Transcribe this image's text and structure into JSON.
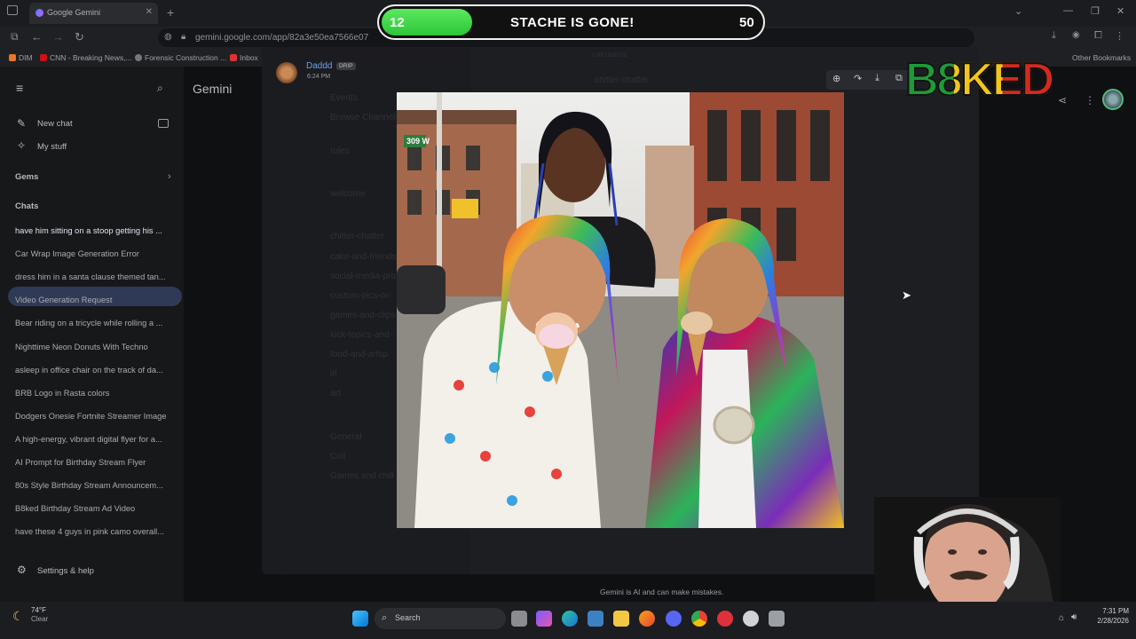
{
  "browser": {
    "tab_title": "Google Gemini",
    "url": "gemini.google.com/app/82a3e50ea7566e07",
    "bookmarks": [
      "DIM",
      "CNN - Breaking News,...",
      "Forensic Construction ...",
      "Inbox"
    ],
    "other_bookmarks": "Other Bookmarks"
  },
  "gemini": {
    "title": "Gemini",
    "new_chat": "New chat",
    "my_stuff": "My stuff",
    "gems": "Gems",
    "chats_header": "Chats",
    "chats": [
      "have him sitting on a stoop getting his ...",
      "Car Wrap Image Generation Error",
      "dress him in a santa clause themed tan...",
      "Video Generation Request",
      "Bear riding on a tricycle while rolling a ...",
      "Nighttime Neon Donuts With Techno",
      "asleep in office chair on the track of da...",
      "BRB Logo in Rasta colors",
      "Dodgers Onesie Fortnite Streamer Image",
      "A high-energy, vibrant digital flyer for a...",
      "AI Prompt for Birthday Stream Flyer",
      "80s Style Birthday Stream Announcem...",
      "B8ked Birthday Stream Ad Video",
      "have these 4 guys in pink camo overall..."
    ],
    "settings": "Settings & help",
    "disclaimer": "Gemini is AI and can make mistakes."
  },
  "discord_viewer": {
    "user": "Daddd",
    "role_badge": "DRIP",
    "time": "6:24 PM",
    "server": "calculators",
    "channel": "chitter-chatter",
    "ghost_channels": [
      "Events",
      "Browse Channels",
      "rules",
      "welcome",
      "chitter-chatter",
      "cake-and-friends",
      "social-media-pro",
      "custom-pics-or-",
      "games-and-clips",
      "kick-topics-and-",
      "food-and-artsp",
      "irl",
      "art",
      "General",
      "Coil",
      "Games and chill"
    ],
    "image_alt_sign": "309 W"
  },
  "stream_overlay": {
    "goal_current": "12",
    "goal_text": "STACHE IS GONE!",
    "goal_target": "50",
    "goal_progress": 0.24,
    "logo_text": "B8KED"
  },
  "taskbar": {
    "weather_temp": "74°F",
    "weather_desc": "Clear",
    "search": "Search",
    "time": "7:31 PM",
    "date": "2/28/2026"
  },
  "colors": {
    "goal_green": "#3ad444",
    "logo_red": "#d42a1e",
    "logo_yellow": "#f3c51c",
    "logo_green": "#1f9a3a"
  }
}
